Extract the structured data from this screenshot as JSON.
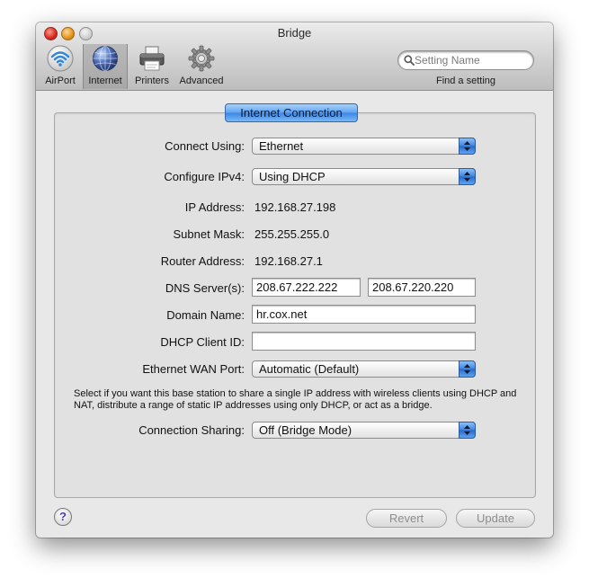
{
  "window": {
    "title": "Bridge"
  },
  "toolbar": {
    "items": [
      {
        "label": "AirPort",
        "icon": "airport-wifi-icon",
        "selected": false
      },
      {
        "label": "Internet",
        "icon": "internet-globe-icon",
        "selected": true
      },
      {
        "label": "Printers",
        "icon": "printer-icon",
        "selected": false
      },
      {
        "label": "Advanced",
        "icon": "gear-icon",
        "selected": false
      }
    ],
    "search": {
      "placeholder": "Setting Name",
      "value": "",
      "label": "Find a setting"
    }
  },
  "panel": {
    "tab": "Internet Connection",
    "fields": {
      "connect_using": {
        "label": "Connect Using:",
        "value": "Ethernet"
      },
      "configure_ipv4": {
        "label": "Configure IPv4:",
        "value": "Using DHCP"
      },
      "ip_address": {
        "label": "IP Address:",
        "value": "192.168.27.198"
      },
      "subnet_mask": {
        "label": "Subnet Mask:",
        "value": "255.255.255.0"
      },
      "router_address": {
        "label": "Router Address:",
        "value": "192.168.27.1"
      },
      "dns_servers": {
        "label": "DNS Server(s):",
        "primary": "208.67.222.222",
        "secondary": "208.67.220.220"
      },
      "domain_name": {
        "label": "Domain Name:",
        "value": "hr.cox.net"
      },
      "dhcp_client_id": {
        "label": "DHCP Client ID:",
        "value": ""
      },
      "ethernet_wan_port": {
        "label": "Ethernet WAN Port:",
        "value": "Automatic (Default)"
      },
      "connection_sharing": {
        "label": "Connection Sharing:",
        "value": "Off (Bridge Mode)"
      }
    },
    "sharing_note": "Select if you want this base station to share a single IP address with wireless clients using DHCP and NAT, distribute a range of static IP addresses using only DHCP, or act as a bridge."
  },
  "footer": {
    "help": "?",
    "revert_label": "Revert",
    "update_label": "Update"
  },
  "colors": {
    "accent": "#3b86e3",
    "disabled_text": "#8d8d8d"
  }
}
